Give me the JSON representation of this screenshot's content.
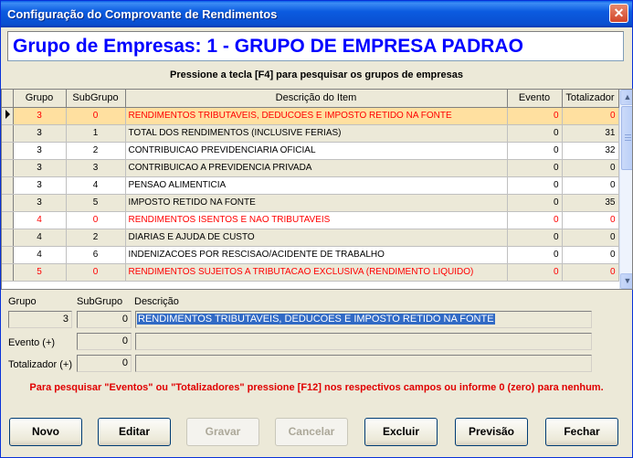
{
  "window": {
    "title": "Configuração do Comprovante de Rendimentos",
    "close_glyph": "✕"
  },
  "group_header": "Grupo de Empresas: 1 - GRUPO DE EMPRESA PADRAO",
  "hint_top": "Pressione a tecla [F4] para pesquisar os grupos de empresas",
  "grid": {
    "columns": [
      "Grupo",
      "SubGrupo",
      "Descrição do Item",
      "Evento",
      "Totalizador"
    ],
    "rows": [
      {
        "grupo": "3",
        "subgrupo": "0",
        "descricao": "RENDIMENTOS TRIBUTAVEIS, DEDUCOES E IMPOSTO RETIDO NA FONTE",
        "evento": "0",
        "totalizador": "0"
      },
      {
        "grupo": "3",
        "subgrupo": "1",
        "descricao": "TOTAL DOS RENDIMENTOS (INCLUSIVE FERIAS)",
        "evento": "0",
        "totalizador": "31"
      },
      {
        "grupo": "3",
        "subgrupo": "2",
        "descricao": "CONTRIBUICAO PREVIDENCIARIA OFICIAL",
        "evento": "0",
        "totalizador": "32"
      },
      {
        "grupo": "3",
        "subgrupo": "3",
        "descricao": "CONTRIBUICAO A PREVIDENCIA PRIVADA",
        "evento": "0",
        "totalizador": "0"
      },
      {
        "grupo": "3",
        "subgrupo": "4",
        "descricao": "PENSAO ALIMENTICIA",
        "evento": "0",
        "totalizador": "0"
      },
      {
        "grupo": "3",
        "subgrupo": "5",
        "descricao": "IMPOSTO RETIDO NA FONTE",
        "evento": "0",
        "totalizador": "35"
      },
      {
        "grupo": "4",
        "subgrupo": "0",
        "descricao": "RENDIMENTOS ISENTOS E NAO TRIBUTAVEIS",
        "evento": "0",
        "totalizador": "0"
      },
      {
        "grupo": "4",
        "subgrupo": "2",
        "descricao": "DIARIAS E AJUDA DE CUSTO",
        "evento": "0",
        "totalizador": "0"
      },
      {
        "grupo": "4",
        "subgrupo": "6",
        "descricao": "INDENIZACOES POR RESCISAO/ACIDENTE DE TRABALHO",
        "evento": "0",
        "totalizador": "0"
      },
      {
        "grupo": "5",
        "subgrupo": "0",
        "descricao": "RENDIMENTOS SUJEITOS A TRIBUTACAO EXCLUSIVA (RENDIMENTO LIQUIDO)",
        "evento": "0",
        "totalizador": "0"
      }
    ]
  },
  "form": {
    "grupo_label": "Grupo",
    "subgrupo_label": "SubGrupo",
    "descricao_label": "Descrição",
    "grupo_value": "3",
    "subgrupo_value": "0",
    "descricao_value": "RENDIMENTOS TRIBUTAVEIS, DEDUCOES E IMPOSTO RETIDO NA FONTE",
    "evento_label": "Evento (+)",
    "evento_value": "0",
    "evento_desc": "",
    "totalizador_label": "Totalizador (+)",
    "totalizador_value": "0",
    "totalizador_desc": ""
  },
  "hint_bottom": "Para pesquisar \"Eventos\" ou \"Totalizadores\" pressione [F12] nos respectivos campos ou informe 0 (zero) para nenhum.",
  "buttons": {
    "novo": "Novo",
    "editar": "Editar",
    "gravar": "Gravar",
    "cancelar": "Cancelar",
    "excluir": "Excluir",
    "previsao": "Previsão",
    "fechar": "Fechar"
  },
  "colors": {
    "red_row": "#ff0000",
    "selected_row": "#ffe0a0",
    "header_blue": "#0000ff"
  }
}
